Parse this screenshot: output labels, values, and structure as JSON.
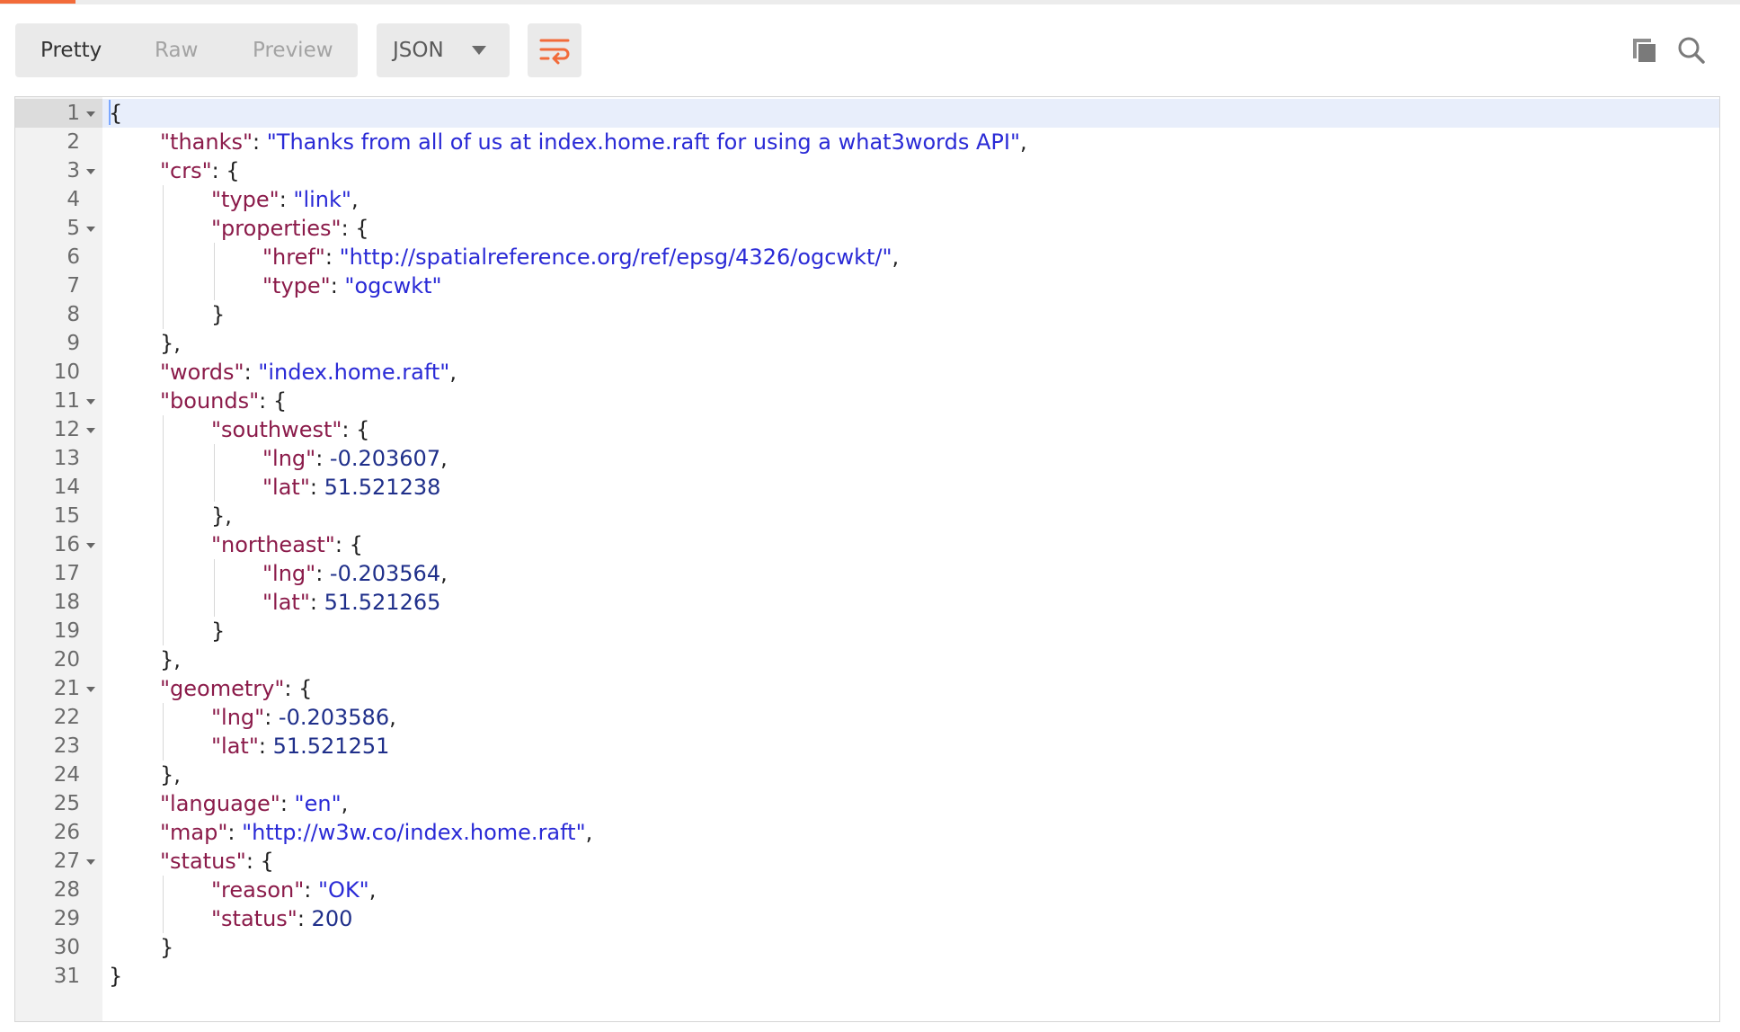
{
  "toolbar": {
    "tabs": [
      {
        "label": "Pretty",
        "active": true
      },
      {
        "label": "Raw",
        "active": false
      },
      {
        "label": "Preview",
        "active": false
      }
    ],
    "format_label": "JSON",
    "wrap_icon": "wrap-lines-icon",
    "copy_icon": "copy-icon",
    "search_icon": "search-icon"
  },
  "colors": {
    "accent": "#f26b3a",
    "json_key": "#8b1b4a",
    "json_string": "#2a2ad6",
    "json_number": "#1f2f8a"
  },
  "code": {
    "lines": [
      {
        "n": "1",
        "fold": true,
        "indent": 0,
        "tokens": [
          {
            "t": "p",
            "v": "{"
          }
        ]
      },
      {
        "n": "2",
        "fold": false,
        "indent": 1,
        "tokens": [
          {
            "t": "k",
            "v": "\"thanks\""
          },
          {
            "t": "p",
            "v": ": "
          },
          {
            "t": "s",
            "v": "\"Thanks from all of us at index.home.raft for using a what3words API\""
          },
          {
            "t": "p",
            "v": ","
          }
        ]
      },
      {
        "n": "3",
        "fold": true,
        "indent": 1,
        "tokens": [
          {
            "t": "k",
            "v": "\"crs\""
          },
          {
            "t": "p",
            "v": ": {"
          }
        ]
      },
      {
        "n": "4",
        "fold": false,
        "indent": 2,
        "tokens": [
          {
            "t": "k",
            "v": "\"type\""
          },
          {
            "t": "p",
            "v": ": "
          },
          {
            "t": "s",
            "v": "\"link\""
          },
          {
            "t": "p",
            "v": ","
          }
        ]
      },
      {
        "n": "5",
        "fold": true,
        "indent": 2,
        "tokens": [
          {
            "t": "k",
            "v": "\"properties\""
          },
          {
            "t": "p",
            "v": ": {"
          }
        ]
      },
      {
        "n": "6",
        "fold": false,
        "indent": 3,
        "tokens": [
          {
            "t": "k",
            "v": "\"href\""
          },
          {
            "t": "p",
            "v": ": "
          },
          {
            "t": "s",
            "v": "\"http://spatialreference.org/ref/epsg/4326/ogcwkt/\""
          },
          {
            "t": "p",
            "v": ","
          }
        ]
      },
      {
        "n": "7",
        "fold": false,
        "indent": 3,
        "tokens": [
          {
            "t": "k",
            "v": "\"type\""
          },
          {
            "t": "p",
            "v": ": "
          },
          {
            "t": "s",
            "v": "\"ogcwkt\""
          }
        ]
      },
      {
        "n": "8",
        "fold": false,
        "indent": 2,
        "tokens": [
          {
            "t": "p",
            "v": "}"
          }
        ]
      },
      {
        "n": "9",
        "fold": false,
        "indent": 1,
        "tokens": [
          {
            "t": "p",
            "v": "},"
          }
        ]
      },
      {
        "n": "10",
        "fold": false,
        "indent": 1,
        "tokens": [
          {
            "t": "k",
            "v": "\"words\""
          },
          {
            "t": "p",
            "v": ": "
          },
          {
            "t": "s",
            "v": "\"index.home.raft\""
          },
          {
            "t": "p",
            "v": ","
          }
        ]
      },
      {
        "n": "11",
        "fold": true,
        "indent": 1,
        "tokens": [
          {
            "t": "k",
            "v": "\"bounds\""
          },
          {
            "t": "p",
            "v": ": {"
          }
        ]
      },
      {
        "n": "12",
        "fold": true,
        "indent": 2,
        "tokens": [
          {
            "t": "k",
            "v": "\"southwest\""
          },
          {
            "t": "p",
            "v": ": {"
          }
        ]
      },
      {
        "n": "13",
        "fold": false,
        "indent": 3,
        "tokens": [
          {
            "t": "k",
            "v": "\"lng\""
          },
          {
            "t": "p",
            "v": ": "
          },
          {
            "t": "n",
            "v": "-0.203607"
          },
          {
            "t": "p",
            "v": ","
          }
        ]
      },
      {
        "n": "14",
        "fold": false,
        "indent": 3,
        "tokens": [
          {
            "t": "k",
            "v": "\"lat\""
          },
          {
            "t": "p",
            "v": ": "
          },
          {
            "t": "n",
            "v": "51.521238"
          }
        ]
      },
      {
        "n": "15",
        "fold": false,
        "indent": 2,
        "tokens": [
          {
            "t": "p",
            "v": "},"
          }
        ]
      },
      {
        "n": "16",
        "fold": true,
        "indent": 2,
        "tokens": [
          {
            "t": "k",
            "v": "\"northeast\""
          },
          {
            "t": "p",
            "v": ": {"
          }
        ]
      },
      {
        "n": "17",
        "fold": false,
        "indent": 3,
        "tokens": [
          {
            "t": "k",
            "v": "\"lng\""
          },
          {
            "t": "p",
            "v": ": "
          },
          {
            "t": "n",
            "v": "-0.203564"
          },
          {
            "t": "p",
            "v": ","
          }
        ]
      },
      {
        "n": "18",
        "fold": false,
        "indent": 3,
        "tokens": [
          {
            "t": "k",
            "v": "\"lat\""
          },
          {
            "t": "p",
            "v": ": "
          },
          {
            "t": "n",
            "v": "51.521265"
          }
        ]
      },
      {
        "n": "19",
        "fold": false,
        "indent": 2,
        "tokens": [
          {
            "t": "p",
            "v": "}"
          }
        ]
      },
      {
        "n": "20",
        "fold": false,
        "indent": 1,
        "tokens": [
          {
            "t": "p",
            "v": "},"
          }
        ]
      },
      {
        "n": "21",
        "fold": true,
        "indent": 1,
        "tokens": [
          {
            "t": "k",
            "v": "\"geometry\""
          },
          {
            "t": "p",
            "v": ": {"
          }
        ]
      },
      {
        "n": "22",
        "fold": false,
        "indent": 2,
        "tokens": [
          {
            "t": "k",
            "v": "\"lng\""
          },
          {
            "t": "p",
            "v": ": "
          },
          {
            "t": "n",
            "v": "-0.203586"
          },
          {
            "t": "p",
            "v": ","
          }
        ]
      },
      {
        "n": "23",
        "fold": false,
        "indent": 2,
        "tokens": [
          {
            "t": "k",
            "v": "\"lat\""
          },
          {
            "t": "p",
            "v": ": "
          },
          {
            "t": "n",
            "v": "51.521251"
          }
        ]
      },
      {
        "n": "24",
        "fold": false,
        "indent": 1,
        "tokens": [
          {
            "t": "p",
            "v": "},"
          }
        ]
      },
      {
        "n": "25",
        "fold": false,
        "indent": 1,
        "tokens": [
          {
            "t": "k",
            "v": "\"language\""
          },
          {
            "t": "p",
            "v": ": "
          },
          {
            "t": "s",
            "v": "\"en\""
          },
          {
            "t": "p",
            "v": ","
          }
        ]
      },
      {
        "n": "26",
        "fold": false,
        "indent": 1,
        "tokens": [
          {
            "t": "k",
            "v": "\"map\""
          },
          {
            "t": "p",
            "v": ": "
          },
          {
            "t": "s",
            "v": "\"http://w3w.co/index.home.raft\""
          },
          {
            "t": "p",
            "v": ","
          }
        ]
      },
      {
        "n": "27",
        "fold": true,
        "indent": 1,
        "tokens": [
          {
            "t": "k",
            "v": "\"status\""
          },
          {
            "t": "p",
            "v": ": {"
          }
        ]
      },
      {
        "n": "28",
        "fold": false,
        "indent": 2,
        "tokens": [
          {
            "t": "k",
            "v": "\"reason\""
          },
          {
            "t": "p",
            "v": ": "
          },
          {
            "t": "s",
            "v": "\"OK\""
          },
          {
            "t": "p",
            "v": ","
          }
        ]
      },
      {
        "n": "29",
        "fold": false,
        "indent": 2,
        "tokens": [
          {
            "t": "k",
            "v": "\"status\""
          },
          {
            "t": "p",
            "v": ": "
          },
          {
            "t": "n",
            "v": "200"
          }
        ]
      },
      {
        "n": "30",
        "fold": false,
        "indent": 1,
        "tokens": [
          {
            "t": "p",
            "v": "}"
          }
        ]
      },
      {
        "n": "31",
        "fold": false,
        "indent": 0,
        "tokens": [
          {
            "t": "p",
            "v": "}"
          }
        ]
      }
    ]
  }
}
